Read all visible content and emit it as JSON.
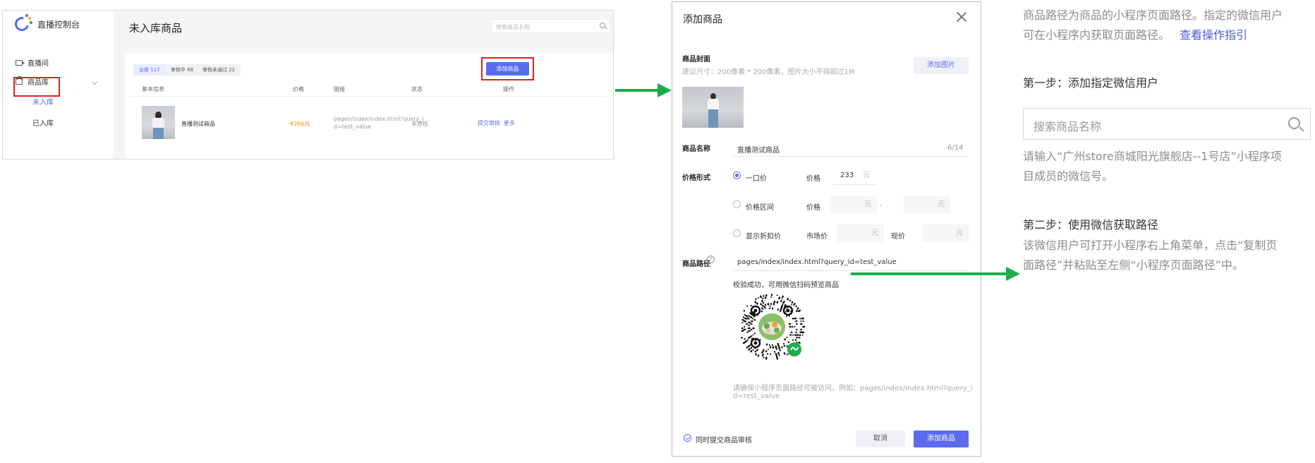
{
  "colors": {
    "accent": "#5b6bef",
    "highlight": "#e0201f",
    "arrow": "#1aad4a",
    "price": "#ff8a00"
  },
  "console": {
    "app_title": "直播控制台",
    "nav": {
      "live_room": "直播间",
      "goods_lib": "商品库",
      "not_in_lib": "未入库",
      "in_lib": "已入库"
    },
    "page_title": "未入库商品",
    "search_placeholder": "搜索商品名称",
    "filters": [
      "全部 117",
      "审核中 68",
      "审核未通过 22"
    ],
    "add_button": "添加商品",
    "columns": [
      "基本信息",
      "价格",
      "链接",
      "状态",
      "操作"
    ],
    "row": {
      "name": "直播测试商品",
      "price": "¥266元",
      "link_line1": "pages/index/index.html?query_i",
      "link_line2": "d=test_value",
      "status": "未审核",
      "action_submit": "提交审核",
      "action_more": "更多"
    }
  },
  "dialog": {
    "title": "添加商品",
    "cover_label": "商品封面",
    "cover_hint": "建议尺寸：200像素 * 200像素，图片大小不得超过1M",
    "add_image_button": "添加图片",
    "name_label": "商品名称",
    "name_value": "直播测试商品",
    "name_count": "6/14",
    "price_form_label": "价格形式",
    "options": [
      "一口价",
      "价格区间",
      "显示折扣价"
    ],
    "price_label": "价格",
    "price_value": "233",
    "unit": "元",
    "range_dash": "-",
    "market_price_label": "市场价",
    "current_price_label": "现价",
    "path_label": "商品路径",
    "path_help": "?",
    "path_value": "pages/index/index.html?query_id=test_value",
    "path_success": "校验成功，可用微信扫码预览商品",
    "path_hint_line1": "请确保小程序页面路径可被访问。例如：pages/index/index.html?query_i",
    "path_hint_line2": "d=test_value",
    "submit_review_label": "同时提交商品审核",
    "cancel_button": "取消",
    "confirm_button": "添加商品"
  },
  "guide": {
    "intro_line1": "商品路径为商品的小程序页面路径。指定的微信用户",
    "intro_line2": "可在小程序内获取页面路径。",
    "guide_link": "查看操作指引",
    "step1_title": "第一步：添加指定微信用户",
    "search_placeholder": "搜索商品名称",
    "step1_desc_line1": "请输入“广州store商城阳光旗舰店--1号店”小程序项",
    "step1_desc_line2": "目成员的微信号。",
    "step2_title": "第二步：使用微信获取路径",
    "step2_desc_line1": "该微信用户可打开小程序右上角菜单，点击“复制页",
    "step2_desc_line2": "面路径”并粘贴至左侧“小程序页面路径”中。"
  }
}
